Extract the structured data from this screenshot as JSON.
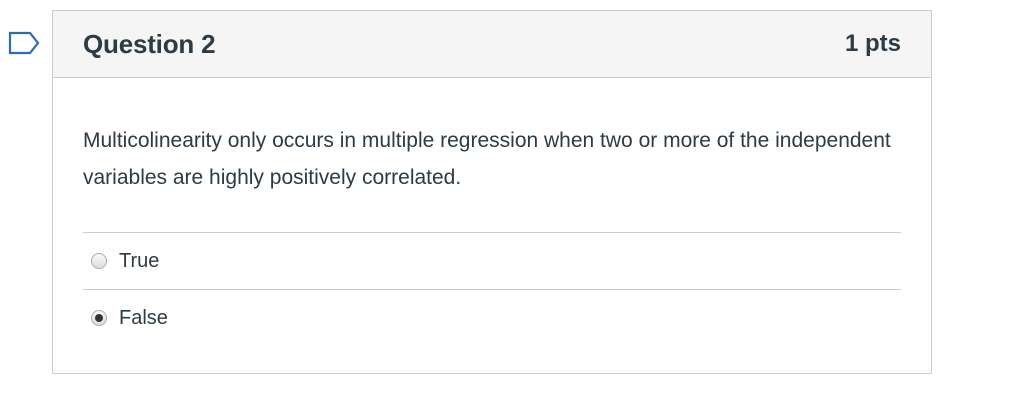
{
  "question": {
    "title": "Question 2",
    "points": "1 pts",
    "text": "Multicolinearity only occurs in multiple regression when two or more of the independent variables are highly positively correlated.",
    "answers": [
      {
        "label": "True",
        "selected": false
      },
      {
        "label": "False",
        "selected": true
      }
    ]
  },
  "icons": {
    "flag": "flag-question-icon"
  },
  "colors": {
    "header_bg": "#f5f5f5",
    "border": "#c7cdd1",
    "text": "#2d3b45",
    "flag": "#2d6cb5"
  }
}
